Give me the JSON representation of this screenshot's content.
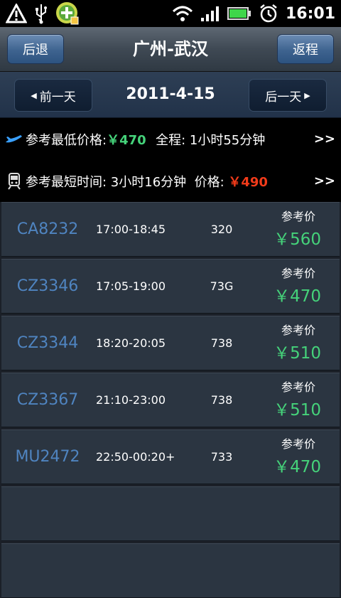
{
  "status_bar": {
    "icons_left": [
      "warning-icon",
      "usb-icon",
      "app-notification-icon"
    ],
    "icons_right": [
      "wifi-icon",
      "signal-icon",
      "battery-icon",
      "alarm-icon"
    ],
    "time": "16:01"
  },
  "header": {
    "back_label": "后退",
    "title": "广州-武汉",
    "return_label": "返程"
  },
  "date_bar": {
    "prev_label": "前一天",
    "date": "2011-4-15",
    "next_label": "后一天"
  },
  "info_lowest": {
    "label": "参考最低价格: ",
    "price": "￥470",
    "duration_label": "  全程: 1小时55分钟",
    "more": ">>"
  },
  "info_shortest": {
    "label": "参考最短时间: 3小时16分钟  价格: ",
    "price": "￥490",
    "more": ">>"
  },
  "flights": [
    {
      "number": "CA8232",
      "time": "17:00-18:45",
      "plane": "320",
      "ref_label": "参考价",
      "price": "￥560"
    },
    {
      "number": "CZ3346",
      "time": "17:05-19:00",
      "plane": "73G",
      "ref_label": "参考价",
      "price": "￥470"
    },
    {
      "number": "CZ3344",
      "time": "18:20-20:05",
      "plane": "738",
      "ref_label": "参考价",
      "price": "￥510"
    },
    {
      "number": "CZ3367",
      "time": "21:10-23:00",
      "plane": "738",
      "ref_label": "参考价",
      "price": "￥510"
    },
    {
      "number": "MU2472",
      "time": "22:50-00:20+",
      "plane": "733",
      "ref_label": "参考价",
      "price": "￥470"
    }
  ],
  "colors": {
    "green": "#45d27a",
    "red": "#f23b1a",
    "flight_blue": "#4f84c0"
  }
}
